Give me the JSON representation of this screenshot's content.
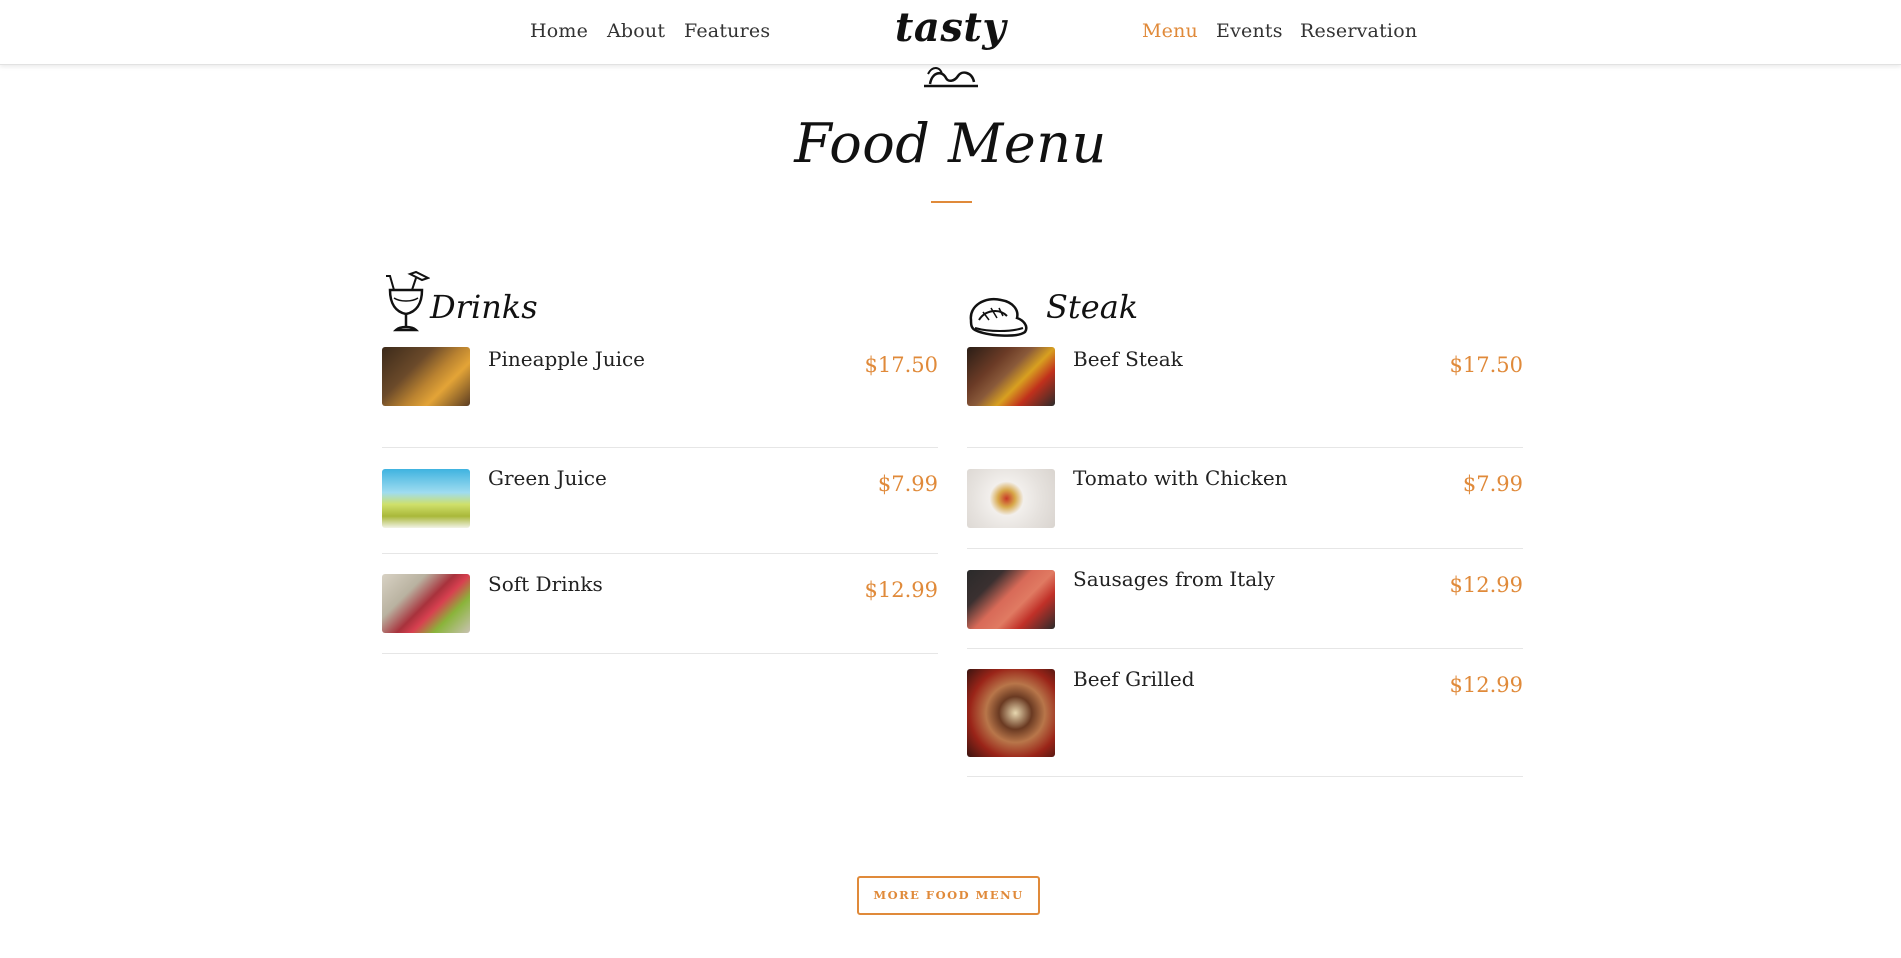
{
  "nav": {
    "brand": "tasty",
    "left_links": [
      "Home",
      "About",
      "Features"
    ],
    "right_links": [
      "Menu",
      "Events",
      "Reservation"
    ],
    "active": "Menu"
  },
  "section": {
    "title": "Food Menu"
  },
  "categories": [
    {
      "name": "Drinks",
      "icon": "cocktail-glass-icon",
      "items": [
        {
          "name": "Pineapple Juice",
          "price": "$17.50",
          "image": "pineapple-juice-photo"
        },
        {
          "name": "Green Juice",
          "price": "$7.99",
          "image": "green-juice-photo"
        },
        {
          "name": "Soft Drinks",
          "price": "$12.99",
          "image": "soft-drinks-photo"
        }
      ]
    },
    {
      "name": "Steak",
      "icon": "steak-icon",
      "items": [
        {
          "name": "Beef Steak",
          "price": "$17.50",
          "image": "beef-steak-photo"
        },
        {
          "name": "Tomato with Chicken",
          "price": "$7.99",
          "image": "tomato-chicken-photo"
        },
        {
          "name": "Sausages from Italy",
          "price": "$12.99",
          "image": "sausages-photo"
        },
        {
          "name": "Beef Grilled",
          "price": "$12.99",
          "image": "beef-grilled-photo"
        }
      ]
    }
  ],
  "more_button": "MORE FOOD MENU",
  "colors": {
    "accent": "#e08a3a",
    "text": "#222222",
    "divider": "#e6e6e6"
  }
}
